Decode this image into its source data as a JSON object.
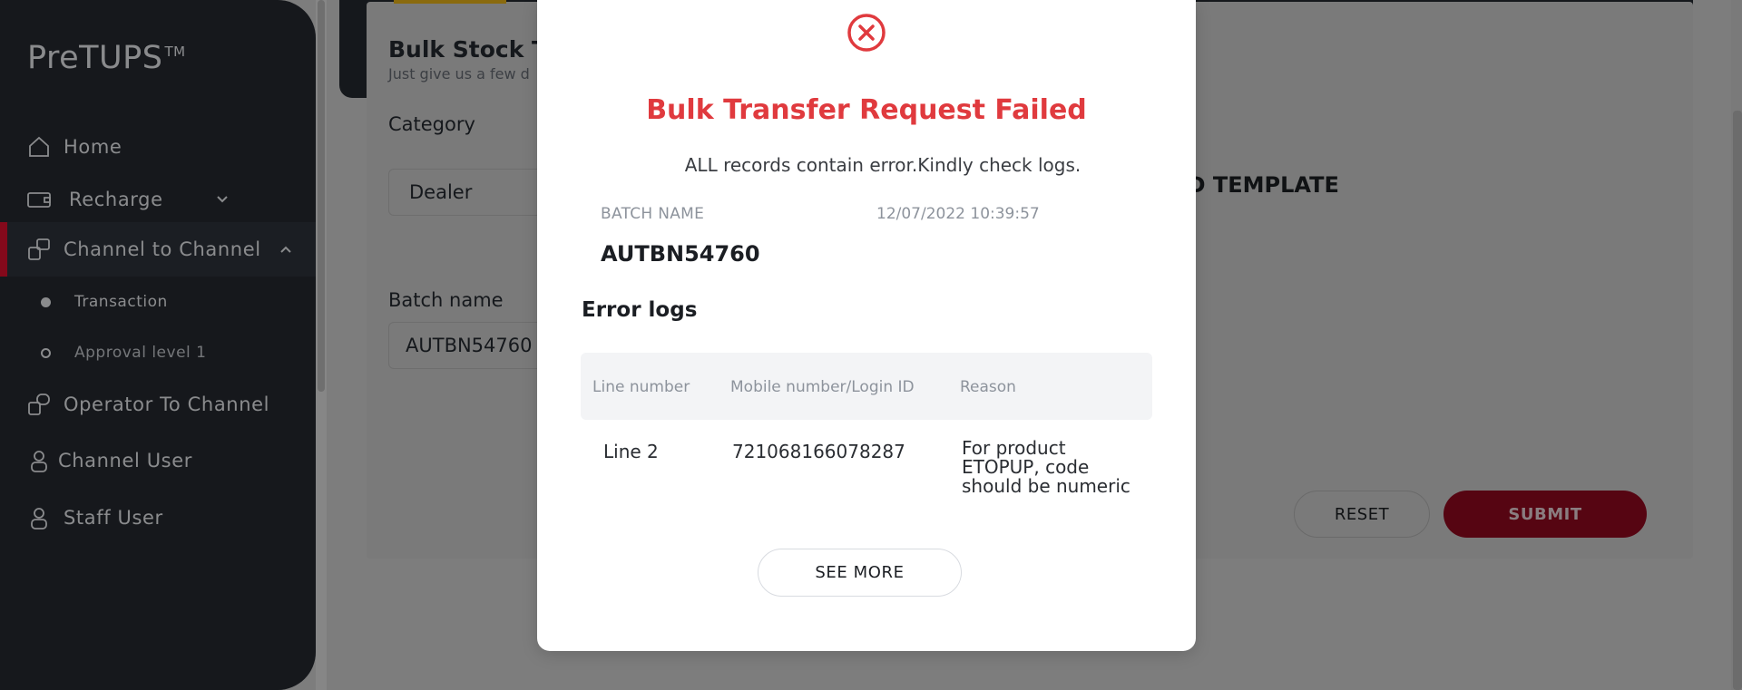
{
  "app": {
    "logo_text": "PreTUPS",
    "logo_tm": "TM"
  },
  "sidebar": {
    "items": [
      {
        "label": "Home",
        "icon": "home-icon"
      },
      {
        "label": "Recharge",
        "icon": "recharge-icon"
      },
      {
        "label": "Channel to Channel",
        "icon": "channel-to-channel-icon"
      },
      {
        "label": "Operator To Channel",
        "icon": "operator-to-channel-icon"
      },
      {
        "label": "Channel User",
        "icon": "user-icon"
      },
      {
        "label": "Staff User",
        "icon": "user-icon"
      }
    ],
    "sub_items": [
      {
        "label": "Transaction"
      },
      {
        "label": "Approval level 1"
      }
    ]
  },
  "page": {
    "title": "Bulk Stock Tra",
    "subtitle": "Just give us a few d",
    "category_label": "Category",
    "category_value": "Dealer",
    "batch_label": "Batch name",
    "batch_value": "AUTBN54760",
    "download_template": "AD TEMPLATE",
    "reset_label": "RESET",
    "submit_label": "SUBMIT"
  },
  "modal": {
    "title": "Bulk Transfer Request Failed",
    "message": "ALL records contain error.Kindly check logs.",
    "batch_name_label": "BATCH NAME",
    "batch_date": "12/07/2022 10:39:57",
    "batch_name_value": "AUTBN54760",
    "error_logs_heading": "Error logs",
    "table": {
      "headers": [
        "Line number",
        "Mobile number/Login ID",
        "Reason"
      ],
      "rows": [
        {
          "line": "Line 2",
          "mobile": "721068166078287",
          "reason": "For product ETOPUP, code should be numeric"
        }
      ]
    },
    "see_more_label": "SEE MORE"
  },
  "colors": {
    "accent_red": "#e03a3e",
    "brand_red": "#e3102f",
    "sidebar_bg": "#262a31"
  }
}
